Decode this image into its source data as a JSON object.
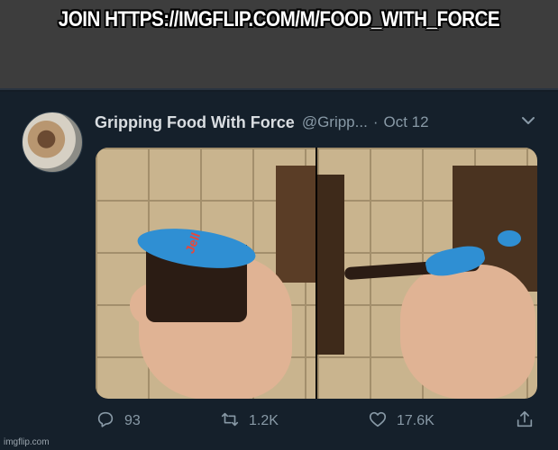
{
  "meme": {
    "caption": "JOIN HTTPS://IMGFLIP.COM/M/FOOD_WITH_FORCE"
  },
  "tweet": {
    "author_name": "Gripping Food With Force",
    "handle": "@Gripp...",
    "separator": "·",
    "date": "Oct 12",
    "menu_icon": "chevron-down-icon",
    "avatar": "avatar-image",
    "media": [
      {
        "description_icon": "pudding-cup-intact-photo",
        "lid_text": "Jell"
      },
      {
        "description_icon": "pudding-cup-crushed-photo",
        "lid_text": ""
      }
    ],
    "actions": {
      "reply": {
        "icon": "reply-icon",
        "count": "93"
      },
      "retweet": {
        "icon": "retweet-icon",
        "count": "1.2K"
      },
      "like": {
        "icon": "heart-icon",
        "count": "17.6K"
      },
      "share": {
        "icon": "share-icon",
        "count": ""
      }
    }
  },
  "watermark": "imgflip.com",
  "colors": {
    "background": "#15202b",
    "caption_band": "#3d3d3d",
    "muted_text": "#8899a6"
  }
}
